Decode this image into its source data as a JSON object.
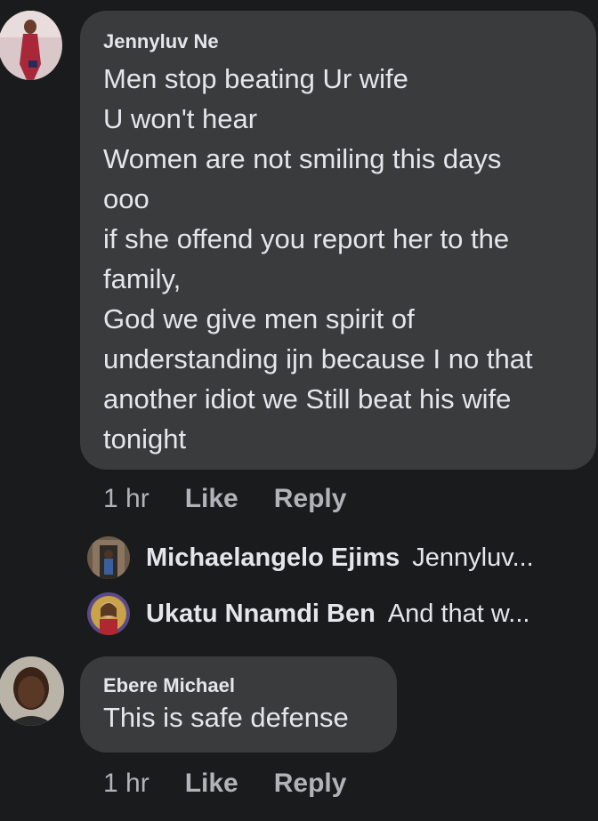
{
  "comments": [
    {
      "author": "Jennyluv Ne",
      "lines": [
        "Men stop beating Ur wife",
        "U won't hear",
        "Women are not smiling this days",
        "ooo",
        "if she offend you report her to the",
        "family,",
        "God we give men spirit of",
        "understanding ijn because I no that",
        "another idiot we Still beat his wife",
        "tonight"
      ],
      "time": "1 hr",
      "like_label": "Like",
      "reply_label": "Reply",
      "avatar_icon": "profile-photo-woman-red-dress"
    },
    {
      "author": "Ebere Michael",
      "lines": [
        "This is safe defense"
      ],
      "time": "1 hr",
      "like_label": "Like",
      "reply_label": "Reply",
      "avatar_icon": "profile-photo-woman-portrait"
    }
  ],
  "replies": [
    {
      "author": "Michaelangelo Ejims",
      "preview": "Jennyluv...",
      "avatar_icon": "profile-photo-man-doorway"
    },
    {
      "author": "Ukatu Nnamdi Ben",
      "preview": "And that w...",
      "avatar_icon": "profile-photo-religious-portrait"
    }
  ],
  "colors": {
    "background": "#1a1b1d",
    "bubble": "#3a3b3c",
    "primary_text": "#e4e6eb",
    "secondary_text": "#b0b3b8"
  }
}
